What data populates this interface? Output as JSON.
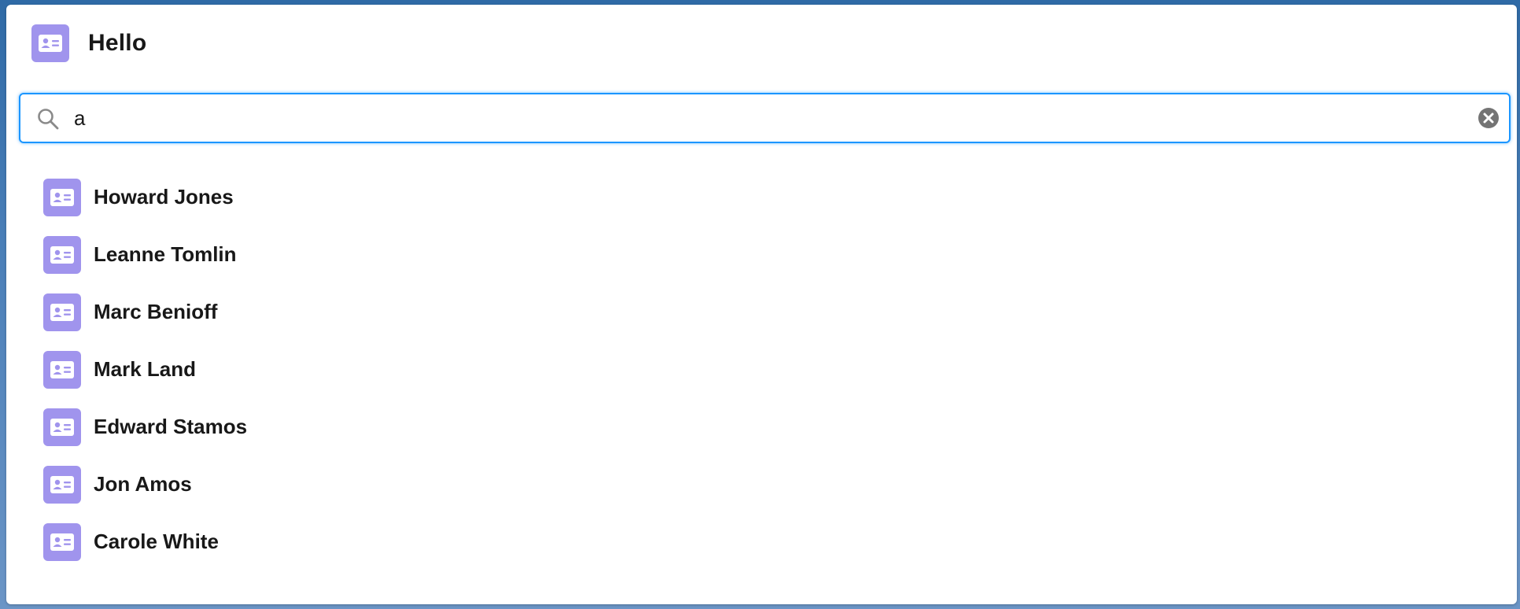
{
  "header": {
    "title": "Hello",
    "icon": "contact-card-icon"
  },
  "search": {
    "value": "a",
    "placeholder": "",
    "search_icon": "search-icon",
    "clear_icon": "clear-icon"
  },
  "results": [
    {
      "name": "Howard Jones",
      "icon": "contact-card-icon"
    },
    {
      "name": "Leanne Tomlin",
      "icon": "contact-card-icon"
    },
    {
      "name": "Marc Benioff",
      "icon": "contact-card-icon"
    },
    {
      "name": "Mark Land",
      "icon": "contact-card-icon"
    },
    {
      "name": "Edward Stamos",
      "icon": "contact-card-icon"
    },
    {
      "name": "Jon Amos",
      "icon": "contact-card-icon"
    },
    {
      "name": "Carole White",
      "icon": "contact-card-icon"
    }
  ],
  "colors": {
    "icon_bg": "#a094ed",
    "focus_border": "#1b96ff",
    "text": "#181818"
  }
}
